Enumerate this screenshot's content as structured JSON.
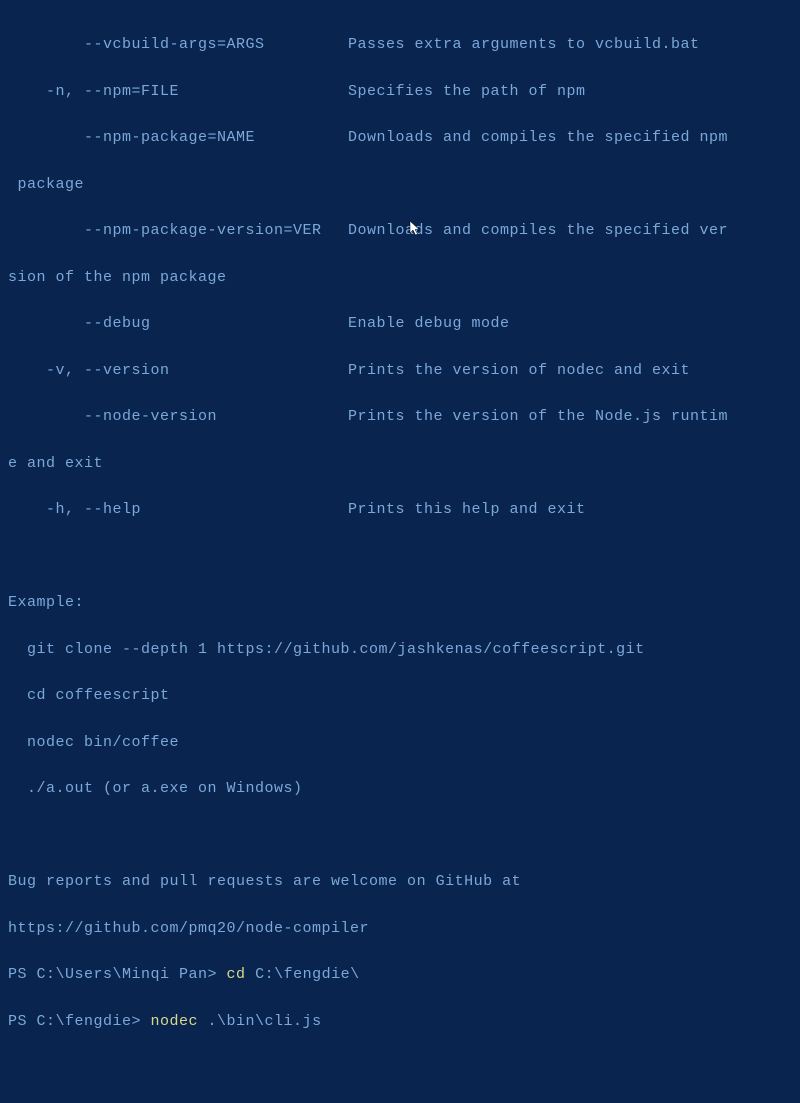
{
  "options": {
    "vcbuild_args": {
      "flag": "        --vcbuild-args=ARGS",
      "desc": "Passes extra arguments to vcbuild.bat"
    },
    "npm": {
      "flag": "    -n, --npm=FILE",
      "desc": "Specifies the path of npm"
    },
    "npm_package": {
      "flag": "        --npm-package=NAME",
      "desc": "Downloads and compiles the specified npm"
    },
    "npm_package_wrap": " package",
    "npm_package_version": {
      "flag": "        --npm-package-version=VER",
      "desc": "Downloads and compiles the specified ver"
    },
    "npm_package_version_wrap": "sion of the npm package",
    "debug": {
      "flag": "        --debug",
      "desc": "Enable debug mode"
    },
    "version": {
      "flag": "    -v, --version",
      "desc": "Prints the version of nodec and exit"
    },
    "node_version": {
      "flag": "        --node-version",
      "desc": "Prints the version of the Node.js runtim"
    },
    "node_version_wrap": "e and exit",
    "help": {
      "flag": "    -h, --help",
      "desc": "Prints this help and exit"
    }
  },
  "example": {
    "header": "Example:",
    "line1": "  git clone --depth 1 https://github.com/jashkenas/coffeescript.git",
    "line2": "  cd coffeescript",
    "line3": "  nodec bin/coffee",
    "line4": "  ./a.out (or a.exe on Windows)"
  },
  "bugs": {
    "line1": "Bug reports and pull requests are welcome on GitHub at",
    "line2": "https://github.com/pmq20/node-compiler"
  },
  "prompts": {
    "p1_prompt": "PS C:\\Users\\Minqi Pan> ",
    "p1_cmd_verb": "cd ",
    "p1_cmd_arg": "C:\\fengdie\\",
    "p2_prompt": "PS C:\\fengdie> ",
    "p2_cmd_verb": "nodec ",
    "p2_cmd_arg": ".\\bin\\cli.js"
  }
}
